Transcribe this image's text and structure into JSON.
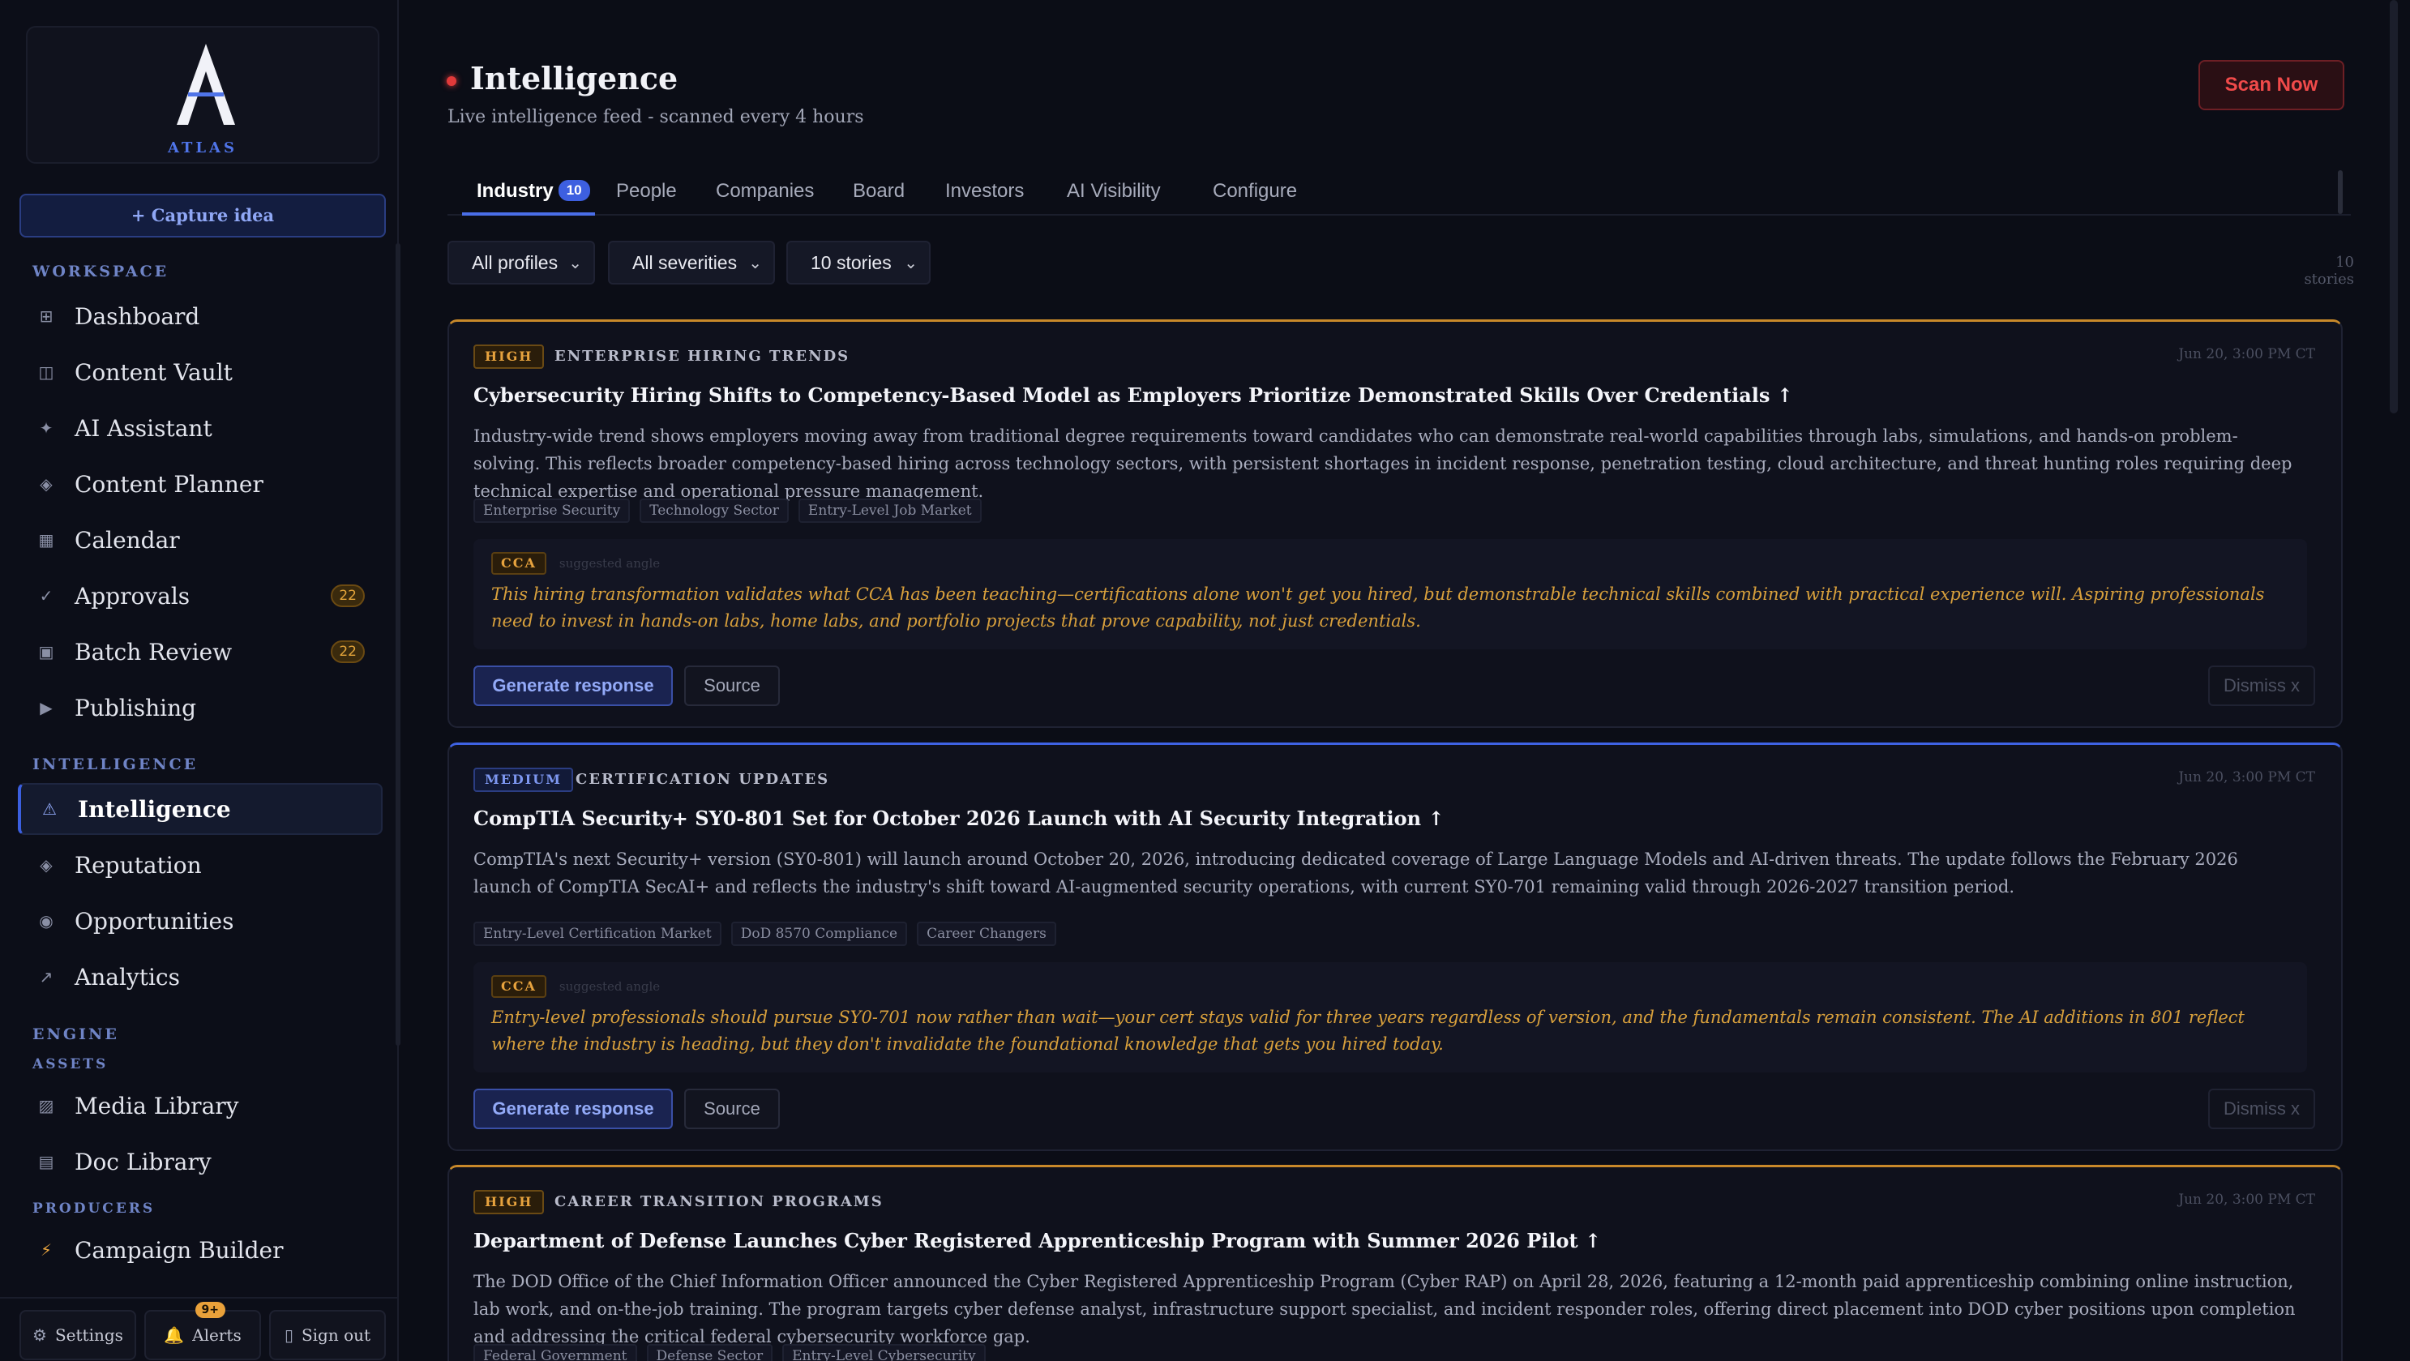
{
  "brand": {
    "logo_letter": "A",
    "name": "ATLAS"
  },
  "sidebar": {
    "capture_label": "+ Capture idea",
    "sections": {
      "workspace": "WORKSPACE",
      "intelligence": "INTELLIGENCE",
      "engine": "ENGINE",
      "assets": "ASSETS",
      "producers": "PRODUCERS"
    },
    "items": [
      {
        "label": "Dashboard",
        "icon": "grid-icon"
      },
      {
        "label": "Content Vault",
        "icon": "vault-icon"
      },
      {
        "label": "AI Assistant",
        "icon": "sparkle-icon"
      },
      {
        "label": "Content Planner",
        "icon": "diamond-icon"
      },
      {
        "label": "Calendar",
        "icon": "calendar-icon"
      },
      {
        "label": "Approvals",
        "icon": "check-icon",
        "count": "22"
      },
      {
        "label": "Batch Review",
        "icon": "batch-icon",
        "count": "22"
      },
      {
        "label": "Publishing",
        "icon": "play-icon"
      },
      {
        "label": "Intelligence",
        "icon": "warning-icon",
        "active": true
      },
      {
        "label": "Reputation",
        "icon": "diamond-icon"
      },
      {
        "label": "Opportunities",
        "icon": "target-icon"
      },
      {
        "label": "Analytics",
        "icon": "trend-icon"
      },
      {
        "label": "Media Library",
        "icon": "media-icon"
      },
      {
        "label": "Doc Library",
        "icon": "doc-icon"
      },
      {
        "label": "Campaign Builder",
        "icon": "lightning-icon"
      }
    ],
    "bottom": {
      "settings": "Settings",
      "alerts": "Alerts",
      "alerts_badge": "9+",
      "signout": "Sign out"
    }
  },
  "header": {
    "title": "Intelligence",
    "subtitle": "Live intelligence feed - scanned every 4 hours",
    "scan_button": "Scan Now"
  },
  "tabs": [
    {
      "label": "Industry",
      "count": "10",
      "active": true
    },
    {
      "label": "People"
    },
    {
      "label": "Companies"
    },
    {
      "label": "Board"
    },
    {
      "label": "Investors"
    },
    {
      "label": "AI Visibility"
    },
    {
      "label": "Configure"
    }
  ],
  "filters": {
    "profiles": "All profiles",
    "severities": "All severities",
    "stories": "10 stories",
    "story_count": "10 stories"
  },
  "cards": [
    {
      "severity": "HIGH",
      "category": "ENTERPRISE HIRING TRENDS",
      "date": "Jun 20, 3:00 PM CT",
      "title": "Cybersecurity Hiring Shifts to Competency-Based Model as Employers Prioritize Demonstrated Skills Over Credentials ↑",
      "body": "Industry-wide trend shows employers moving away from traditional degree requirements toward candidates who can demonstrate real-world capabilities through labs, simulations, and hands-on problem-solving. This reflects broader competency-based hiring across technology sectors, with persistent shortages in incident response, penetration testing, cloud architecture, and threat hunting roles requiring deep technical expertise and operational pressure management.",
      "tags": [
        "Enterprise Security",
        "Technology Sector",
        "Entry-Level Job Market"
      ],
      "angle_badge": "CCA",
      "angle_note": "suggested angle",
      "angle_text": "This hiring transformation validates what CCA has been teaching—certifications alone won't get you hired, but demonstrable technical skills combined with practical experience will. Aspiring professionals need to invest in hands-on labs, home labs, and portfolio projects that prove capability, not just credentials.",
      "generate": "Generate response",
      "source": "Source",
      "dismiss": "Dismiss x"
    },
    {
      "severity": "MEDIUM",
      "category": "CERTIFICATION UPDATES",
      "date": "Jun 20, 3:00 PM CT",
      "title": "CompTIA Security+ SY0-801 Set for October 2026 Launch with AI Security Integration ↑",
      "body": "CompTIA's next Security+ version (SY0-801) will launch around October 20, 2026, introducing dedicated coverage of Large Language Models and AI-driven threats. The update follows the February 2026 launch of CompTIA SecAI+ and reflects the industry's shift toward AI-augmented security operations, with current SY0-701 remaining valid through 2026-2027 transition period.",
      "tags": [
        "Entry-Level Certification Market",
        "DoD 8570 Compliance",
        "Career Changers"
      ],
      "angle_badge": "CCA",
      "angle_note": "suggested angle",
      "angle_text": "Entry-level professionals should pursue SY0-701 now rather than wait—your cert stays valid for three years regardless of version, and the fundamentals remain consistent. The AI additions in 801 reflect where the industry is heading, but they don't invalidate the foundational knowledge that gets you hired today.",
      "generate": "Generate response",
      "source": "Source",
      "dismiss": "Dismiss x"
    },
    {
      "severity": "HIGH",
      "category": "CAREER TRANSITION PROGRAMS",
      "date": "Jun 20, 3:00 PM CT",
      "title": "Department of Defense Launches Cyber Registered Apprenticeship Program with Summer 2026 Pilot ↑",
      "body": "The DOD Office of the Chief Information Officer announced the Cyber Registered Apprenticeship Program (Cyber RAP) on April 28, 2026, featuring a 12-month paid apprenticeship combining online instruction, lab work, and on-the-job training. The program targets cyber defense analyst, infrastructure support specialist, and incident responder roles, offering direct placement into DOD cyber positions upon completion and addressing the critical federal cybersecurity workforce gap.",
      "tags": [
        "Federal Government",
        "Defense Sector",
        "Entry-Level Cybersecurity"
      ]
    }
  ],
  "colors": {
    "accent": "#3d5fe0",
    "high": "#e7a33e",
    "medium": "#7d97f0",
    "live": "#e23a3a"
  }
}
